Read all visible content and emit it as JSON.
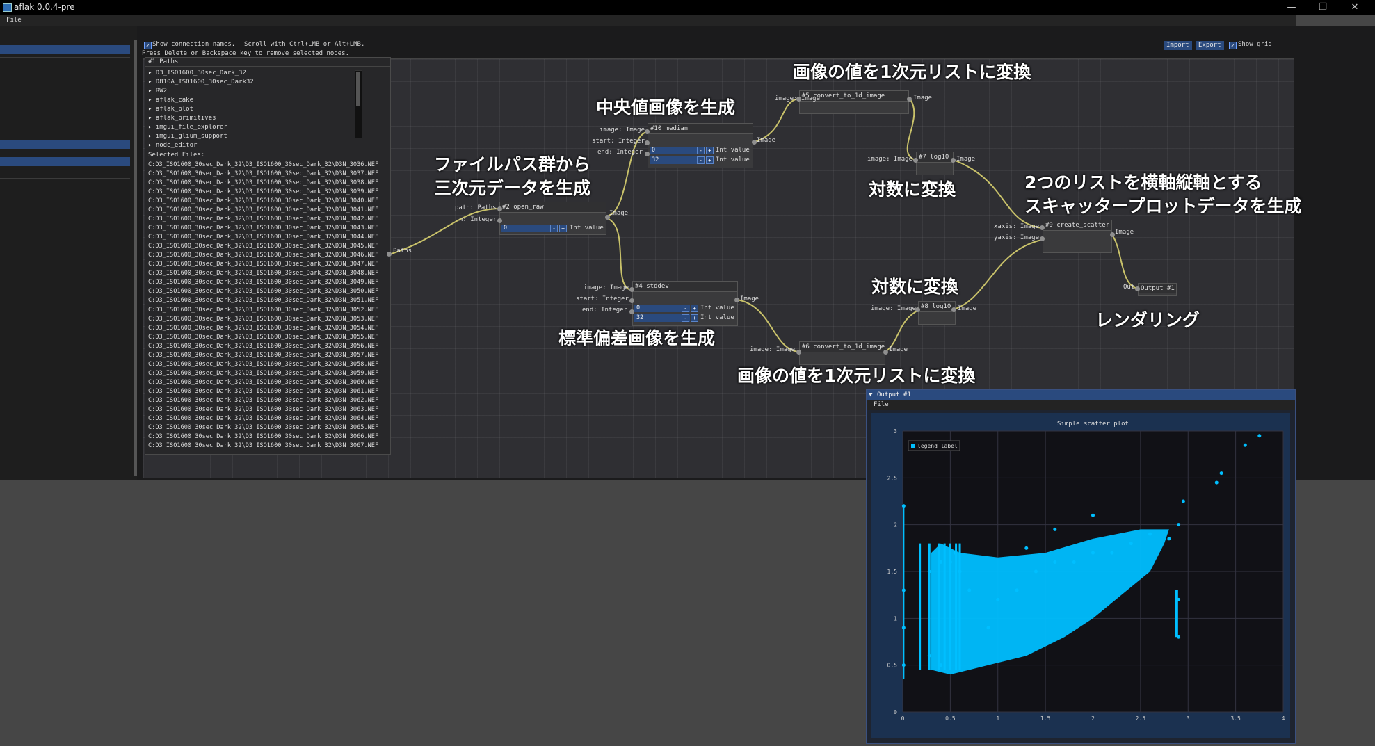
{
  "window": {
    "title": "aflak 0.0.4-pre",
    "controls": {
      "minimize": "—",
      "maximize": "❐",
      "close": "✕"
    }
  },
  "menubar": {
    "file": "File"
  },
  "toolbar": {
    "show_connection_names": "Show connection names.",
    "hint1": "Scroll with Ctrl+LMB or Alt+LMB.",
    "hint2": "Press Delete or Backspace key to remove selected nodes.",
    "import": "Import",
    "export": "Export",
    "show_grid": "Show grid"
  },
  "paths_node": {
    "title": "#1 Paths",
    "tree": [
      "▸ D3_ISO1600_30sec_Dark_32",
      "▸ D810A_ISO1600_30sec_Dark32",
      "▸ RW2",
      "▸ aflak_cake",
      "▸ aflak_plot",
      "▸ aflak_primitives",
      "▸ imgui_file_explorer",
      "▸ imgui_glium_support",
      "▸ node_editor"
    ],
    "selected_label": "Selected Files:",
    "files": [
      "C:D3_ISO1600_30sec_Dark_32\\D3_ISO1600_30sec_Dark_32\\D3N_3036.NEF",
      "C:D3_ISO1600_30sec_Dark_32\\D3_ISO1600_30sec_Dark_32\\D3N_3037.NEF",
      "C:D3_ISO1600_30sec_Dark_32\\D3_ISO1600_30sec_Dark_32\\D3N_3038.NEF",
      "C:D3_ISO1600_30sec_Dark_32\\D3_ISO1600_30sec_Dark_32\\D3N_3039.NEF",
      "C:D3_ISO1600_30sec_Dark_32\\D3_ISO1600_30sec_Dark_32\\D3N_3040.NEF",
      "C:D3_ISO1600_30sec_Dark_32\\D3_ISO1600_30sec_Dark_32\\D3N_3041.NEF",
      "C:D3_ISO1600_30sec_Dark_32\\D3_ISO1600_30sec_Dark_32\\D3N_3042.NEF",
      "C:D3_ISO1600_30sec_Dark_32\\D3_ISO1600_30sec_Dark_32\\D3N_3043.NEF",
      "C:D3_ISO1600_30sec_Dark_32\\D3_ISO1600_30sec_Dark_32\\D3N_3044.NEF",
      "C:D3_ISO1600_30sec_Dark_32\\D3_ISO1600_30sec_Dark_32\\D3N_3045.NEF",
      "C:D3_ISO1600_30sec_Dark_32\\D3_ISO1600_30sec_Dark_32\\D3N_3046.NEF",
      "C:D3_ISO1600_30sec_Dark_32\\D3_ISO1600_30sec_Dark_32\\D3N_3047.NEF",
      "C:D3_ISO1600_30sec_Dark_32\\D3_ISO1600_30sec_Dark_32\\D3N_3048.NEF",
      "C:D3_ISO1600_30sec_Dark_32\\D3_ISO1600_30sec_Dark_32\\D3N_3049.NEF",
      "C:D3_ISO1600_30sec_Dark_32\\D3_ISO1600_30sec_Dark_32\\D3N_3050.NEF",
      "C:D3_ISO1600_30sec_Dark_32\\D3_ISO1600_30sec_Dark_32\\D3N_3051.NEF",
      "C:D3_ISO1600_30sec_Dark_32\\D3_ISO1600_30sec_Dark_32\\D3N_3052.NEF",
      "C:D3_ISO1600_30sec_Dark_32\\D3_ISO1600_30sec_Dark_32\\D3N_3053.NEF",
      "C:D3_ISO1600_30sec_Dark_32\\D3_ISO1600_30sec_Dark_32\\D3N_3054.NEF",
      "C:D3_ISO1600_30sec_Dark_32\\D3_ISO1600_30sec_Dark_32\\D3N_3055.NEF",
      "C:D3_ISO1600_30sec_Dark_32\\D3_ISO1600_30sec_Dark_32\\D3N_3056.NEF",
      "C:D3_ISO1600_30sec_Dark_32\\D3_ISO1600_30sec_Dark_32\\D3N_3057.NEF",
      "C:D3_ISO1600_30sec_Dark_32\\D3_ISO1600_30sec_Dark_32\\D3N_3058.NEF",
      "C:D3_ISO1600_30sec_Dark_32\\D3_ISO1600_30sec_Dark_32\\D3N_3059.NEF",
      "C:D3_ISO1600_30sec_Dark_32\\D3_ISO1600_30sec_Dark_32\\D3N_3060.NEF",
      "C:D3_ISO1600_30sec_Dark_32\\D3_ISO1600_30sec_Dark_32\\D3N_3061.NEF",
      "C:D3_ISO1600_30sec_Dark_32\\D3_ISO1600_30sec_Dark_32\\D3N_3062.NEF",
      "C:D3_ISO1600_30sec_Dark_32\\D3_ISO1600_30sec_Dark_32\\D3N_3063.NEF",
      "C:D3_ISO1600_30sec_Dark_32\\D3_ISO1600_30sec_Dark_32\\D3N_3064.NEF",
      "C:D3_ISO1600_30sec_Dark_32\\D3_ISO1600_30sec_Dark_32\\D3N_3065.NEF",
      "C:D3_ISO1600_30sec_Dark_32\\D3_ISO1600_30sec_Dark_32\\D3N_3066.NEF",
      "C:D3_ISO1600_30sec_Dark_32\\D3_ISO1600_30sec_Dark_32\\D3N_3067.NEF"
    ],
    "output_port": "Paths"
  },
  "nodes": {
    "open_raw": {
      "title": "#2 open_raw",
      "in1": "path: Paths",
      "in2": "n: Integer",
      "out": "Image",
      "field_value": "0",
      "field_label": "Int value"
    },
    "median": {
      "title": "#10 median",
      "in1": "image: Image",
      "in2": "start: Integer",
      "in3": "end: Integer",
      "out": "Image",
      "v1": "0",
      "v2": "32",
      "label": "Int value"
    },
    "stddev": {
      "title": "#4 stddev",
      "in1": "image: Image",
      "in2": "start: Integer",
      "in3": "end: Integer",
      "out": "Image",
      "v1": "0",
      "v2": "32",
      "label": "Int value"
    },
    "conv5": {
      "title": "#5 convert_to_1d_image",
      "in1": "image: Image",
      "out": "Image"
    },
    "conv6": {
      "title": "#6 convert_to_1d_image",
      "in1": "image: Image",
      "out": "Image"
    },
    "log7": {
      "title": "#7 log10",
      "in1": "image: Image",
      "out": "Image"
    },
    "log8": {
      "title": "#8 log10",
      "in1": "image: Image",
      "out": "Image"
    },
    "scatter": {
      "title": "#9 create_scatter",
      "in1": "xaxis: Image",
      "in2": "yaxis: Image",
      "out": "Image"
    },
    "output": {
      "title": "Output #1",
      "in1": "Out"
    }
  },
  "annotations": {
    "paths_to_3d": "ファイルパス群から\n三次元データを生成",
    "median": "中央値画像を生成",
    "stddev": "標準偏差画像を生成",
    "to1d_top": "画像の値を1次元リストに変換",
    "to1d_bottom": "画像の値を1次元リストに変換",
    "log_top": "対数に変換",
    "log_bottom": "対数に変換",
    "scatter": "2つのリストを横軸縦軸とする\nスキャッタープロットデータを生成",
    "rendering": "レンダリング"
  },
  "output_window": {
    "title": "Output #1",
    "menu": "File"
  },
  "colors": {
    "accent": "#2a4a7e",
    "point": "#00bfff",
    "wire": "#c9c26a"
  },
  "chart_data": {
    "type": "scatter",
    "title": "Simple scatter plot",
    "legend": [
      "legend label"
    ],
    "legend_position": "top-left",
    "xlim": [
      0,
      4
    ],
    "ylim": [
      0,
      3
    ],
    "xticks": [
      "0",
      "0.5",
      "1",
      "1.5",
      "2",
      "2.5",
      "3",
      "3.5",
      "4"
    ],
    "yticks": [
      "0",
      "0.5",
      "1",
      "1.5",
      "2",
      "2.5",
      "3"
    ],
    "grid": true,
    "series": [
      {
        "name": "legend label",
        "color": "#00bfff",
        "points": [
          [
            0.01,
            0.5
          ],
          [
            0.01,
            0.9
          ],
          [
            0.01,
            1.3
          ],
          [
            0.01,
            2.2
          ],
          [
            0.28,
            0.6
          ],
          [
            0.28,
            1.5
          ],
          [
            0.4,
            0.5
          ],
          [
            0.4,
            1.6
          ],
          [
            0.5,
            1.6
          ],
          [
            0.55,
            1.7
          ],
          [
            0.6,
            1.5
          ],
          [
            0.7,
            1.3
          ],
          [
            0.9,
            0.9
          ],
          [
            1.0,
            1.2
          ],
          [
            1.2,
            1.3
          ],
          [
            1.4,
            1.5
          ],
          [
            1.6,
            1.6
          ],
          [
            1.8,
            1.6
          ],
          [
            2.0,
            1.7
          ],
          [
            2.2,
            1.7
          ],
          [
            2.4,
            1.8
          ],
          [
            2.6,
            1.9
          ],
          [
            2.8,
            1.85
          ],
          [
            2.9,
            2.0
          ],
          [
            2.9,
            1.2
          ],
          [
            2.9,
            0.8
          ],
          [
            2.95,
            2.25
          ],
          [
            3.3,
            2.45
          ],
          [
            3.35,
            2.55
          ],
          [
            3.6,
            2.85
          ],
          [
            3.75,
            2.95
          ],
          [
            2.0,
            2.1
          ],
          [
            1.3,
            1.75
          ],
          [
            1.6,
            1.95
          ]
        ]
      }
    ]
  }
}
